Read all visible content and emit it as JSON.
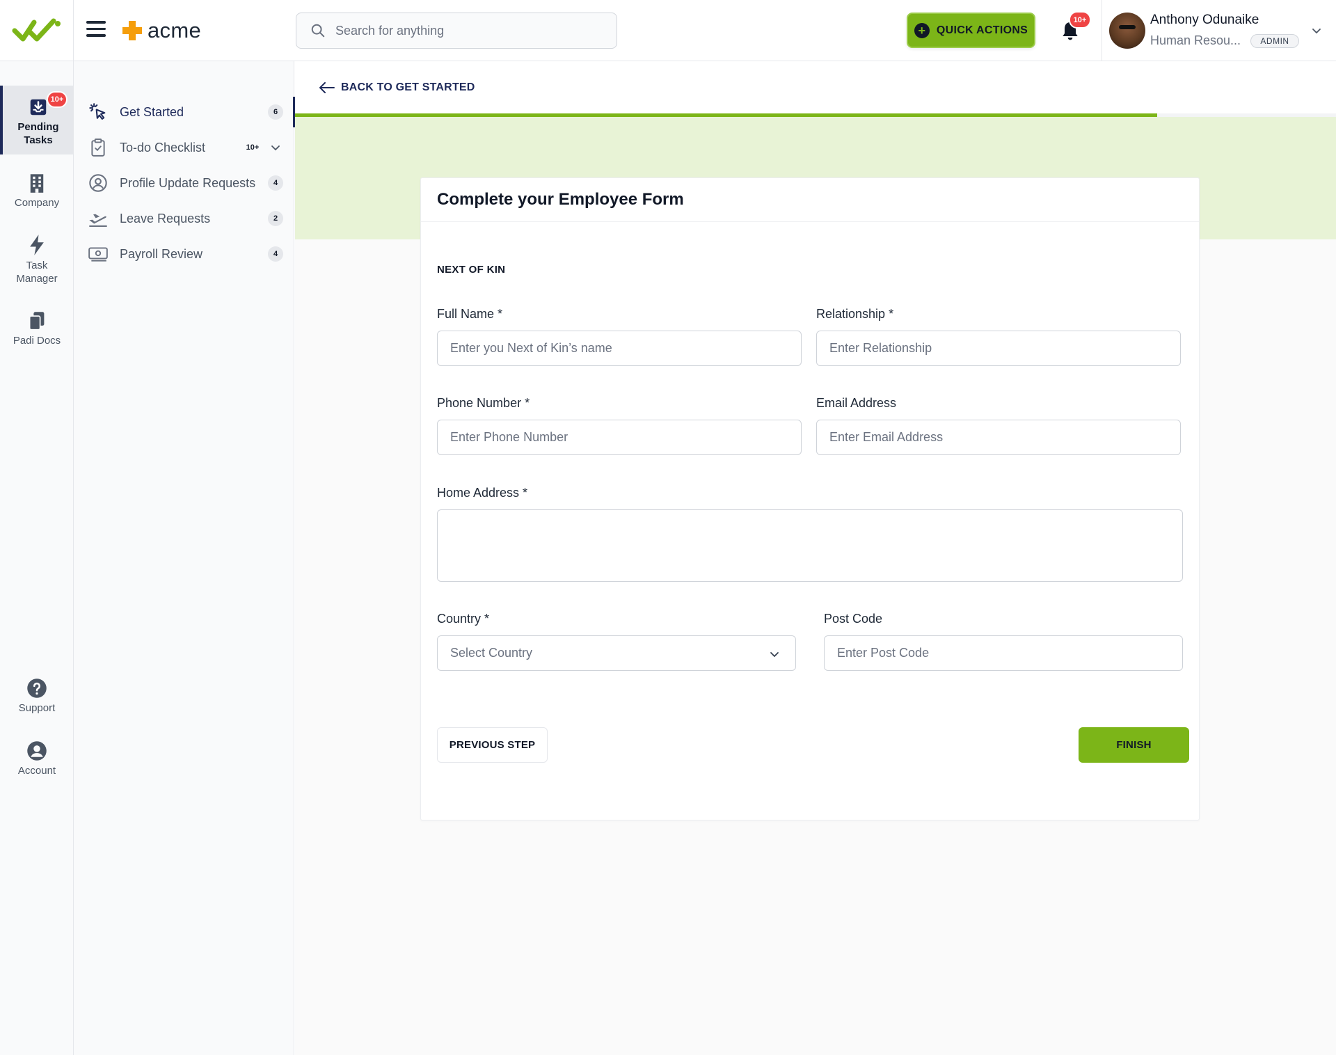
{
  "app": {
    "brand_name": "acme",
    "colors": {
      "accent": "#7cb518",
      "navy": "#1e2a5a",
      "danger": "#ef4444",
      "band": "#e8f3d6"
    }
  },
  "header": {
    "search_placeholder": "Search for anything",
    "quick_actions_label": "QUICK ACTIONS",
    "notification_count": "10+",
    "user": {
      "name": "Anthony Odunaike",
      "role": "Human Resou...",
      "badge": "ADMIN"
    }
  },
  "rail": {
    "items": [
      {
        "label_line1": "Pending",
        "label_line2": "Tasks",
        "icon": "inbox-download-icon",
        "badge": "10+",
        "active": true
      },
      {
        "label_line1": "Company",
        "label_line2": "",
        "icon": "building-icon"
      },
      {
        "label_line1": "Task",
        "label_line2": "Manager",
        "icon": "lightning-icon"
      },
      {
        "label_line1": "Padi Docs",
        "label_line2": "",
        "icon": "documents-icon"
      },
      {
        "label_line1": "Support",
        "label_line2": "",
        "icon": "question-circle-icon"
      },
      {
        "label_line1": "Account",
        "label_line2": "",
        "icon": "user-circle-icon"
      }
    ]
  },
  "subnav": {
    "items": [
      {
        "label": "Get Started",
        "count": "6",
        "icon": "cursor-click-icon",
        "active": true
      },
      {
        "label": "To-do Checklist",
        "count": "10+",
        "icon": "clipboard-check-icon",
        "expandable": true
      },
      {
        "label": "Profile Update Requests",
        "count": "4",
        "icon": "user-circle-icon"
      },
      {
        "label": "Leave Requests",
        "count": "2",
        "icon": "airplane-takeoff-icon"
      },
      {
        "label": "Payroll Review",
        "count": "4",
        "icon": "cash-icon"
      }
    ]
  },
  "main": {
    "back_label": "BACK TO GET STARTED",
    "progress_percent": 82.8,
    "form": {
      "title": "Complete your Employee Form",
      "section": "NEXT OF KIN",
      "fields": {
        "full_name": {
          "label": "Full Name *",
          "placeholder": "Enter you Next of Kin’s name"
        },
        "relationship": {
          "label": "Relationship *",
          "placeholder": "Enter Relationship"
        },
        "phone": {
          "label": "Phone Number *",
          "placeholder": "Enter Phone Number"
        },
        "email": {
          "label": "Email Address",
          "placeholder": "Enter Email Address"
        },
        "home_address": {
          "label": "Home Address *",
          "placeholder": ""
        },
        "country": {
          "label": "Country *",
          "value": "Select Country"
        },
        "post_code": {
          "label": "Post Code",
          "placeholder": "Enter Post Code"
        }
      },
      "previous_label": "PREVIOUS STEP",
      "finish_label": "FINISH"
    }
  }
}
